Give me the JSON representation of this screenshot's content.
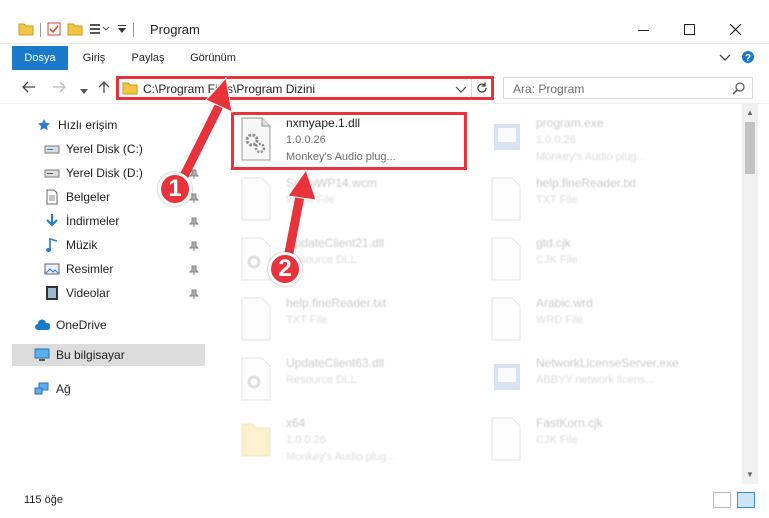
{
  "window": {
    "title": "Program"
  },
  "ribbon": {
    "tabs": [
      {
        "label": "Dosya",
        "active": true
      },
      {
        "label": "Giriş"
      },
      {
        "label": "Paylaş"
      },
      {
        "label": "Görünüm"
      }
    ]
  },
  "address": {
    "path": "C:\\Program Files\\Program Dizini"
  },
  "search": {
    "placeholder": "Ara: Program"
  },
  "sidebar": {
    "items": [
      {
        "label": "Hızlı erişim",
        "icon": "star-icon"
      },
      {
        "label": "Yerel Disk (C:)",
        "icon": "drive-icon",
        "pinned": true
      },
      {
        "label": "Yerel Disk (D:)",
        "icon": "drive-icon",
        "pinned": true
      },
      {
        "label": "Belgeler",
        "icon": "documents-icon",
        "pinned": true
      },
      {
        "label": "İndirmeler",
        "icon": "download-icon",
        "pinned": true
      },
      {
        "label": "Müzik",
        "icon": "music-icon",
        "pinned": true
      },
      {
        "label": "Resimler",
        "icon": "pictures-icon",
        "pinned": true
      },
      {
        "label": "Videolar",
        "icon": "videos-icon",
        "pinned": true
      },
      {
        "label": "OneDrive",
        "icon": "cloud-icon"
      },
      {
        "label": "Bu bilgisayar",
        "icon": "computer-icon",
        "selected": true
      },
      {
        "label": "Ağ",
        "icon": "network-icon"
      }
    ]
  },
  "files": [
    {
      "name": "nxmyape.1.dll",
      "line2": "1.0.0.26",
      "line3": "Monkey's Audio plug...",
      "highlighted": true
    },
    {
      "name": "program.exe",
      "line2": "1.0.0.26",
      "line3": "Monkey's Audio plug...",
      "faded": true
    },
    {
      "name": "SnowWP14.wcm",
      "line2": "WCM File",
      "line3": "",
      "faded": true
    },
    {
      "name": "help.fineReader.txt",
      "line2": "TXT File",
      "line3": "",
      "faded": true
    },
    {
      "name": "UpdateClient21.dll",
      "line2": "Resource DLL",
      "line3": "",
      "faded": true
    },
    {
      "name": "gtd.cjk",
      "line2": "CJK File",
      "line3": "",
      "faded": true
    },
    {
      "name": "help.fineReader.txt",
      "line2": "TXT File",
      "line3": "",
      "faded": true
    },
    {
      "name": "Arabic.wrd",
      "line2": "WRD File",
      "line3": "",
      "faded": true
    },
    {
      "name": "UpdateClient63.dll",
      "line2": "Resource DLL",
      "line3": "",
      "faded": true
    },
    {
      "name": "NetworkLicenseServer.exe",
      "line2": "ABBYY network licens...",
      "line3": "",
      "faded": true
    },
    {
      "name": "x64",
      "line2": "1.0.0.26",
      "line3": "Monkey's Audio plug...",
      "faded": true
    },
    {
      "name": "FastKorn.cjk",
      "line2": "CJK File",
      "line3": "",
      "faded": true
    }
  ],
  "status": {
    "item_count": "115 öğe"
  },
  "callouts": [
    "1",
    "2"
  ],
  "colors": {
    "accent": "#1979ca",
    "annotation": "#e8323c"
  }
}
